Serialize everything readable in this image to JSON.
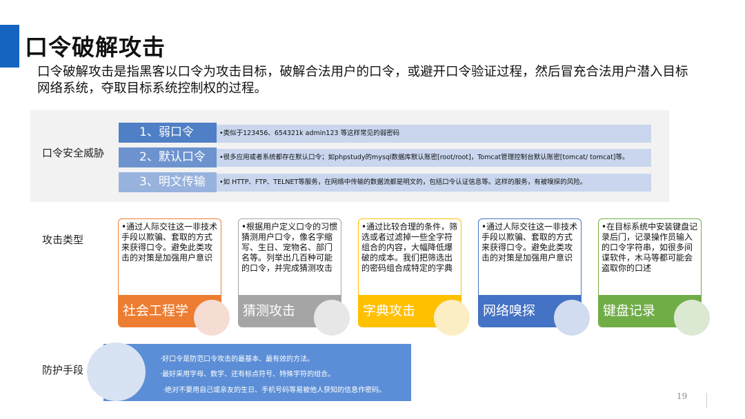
{
  "title": "口令破解攻击",
  "intro": "口令破解攻击是指黑客以口令为攻击目标，破解合法用户的口令，或避开口令验证过程，然后冒充合法用户潜入目标网络系统，夺取目标系统控制权的过程。",
  "threats": {
    "label": "口令安全威胁",
    "items": [
      {
        "name": "1、弱口令",
        "desc": "•类似于123456、654321k admin123 等这样常见的弱密码"
      },
      {
        "name": "2、默认口令",
        "desc": "•很多应用或者系统都存在默认口令；如phpstudy的mysql数据库默认账密[root/root]，Tomcat管理控制台默认账密[tomcat/ tomcat]等。"
      },
      {
        "name": "3、明文传输",
        "desc": "•如   HTTP、FTP、TELNET等服务，在网络中传输的数据流都是明文的，包括口令认证信息等。这样的服务，有被嗅探的风险。"
      }
    ]
  },
  "attacks": {
    "label": "攻击类型",
    "cards": [
      {
        "title": "社会工程学",
        "text": "•通过人际交往这一非技术手段以欺骗、套取的方式来获得口令。避免此类攻击的对策是加强用户意识"
      },
      {
        "title": "猜测攻击",
        "text": "•根据用户定义口令的习惯猜测用户口令，像名字缩写、生日、宠物名、部门名等。列举出几百种可能的口令，并完成猜测攻击"
      },
      {
        "title": "字典攻击",
        "text": "•通过比较合理的条件，筛选或者过滤掉一些全字符组合的内容，大幅降低爆破的成本。我们把筛选出的密码组合成特定的字典"
      },
      {
        "title": "网络嗅探",
        "text": "•通过人际交往这一非技术手段以欺骗、套取的方式来获得口令。避免此类攻击的对策是加强用户意识"
      },
      {
        "title": "键盘记录",
        "text": "•在目标系统中安装键盘记录后门，记录操作员输入的口令字符串，如很多间谍软件，木马等都可能会盗取你的口述"
      }
    ]
  },
  "defense": {
    "label": "防护手段",
    "lines": [
      "·好口令是防范口令攻击的最基本、最有效的方法。",
      "·最好采用字母、数字、还有标点符号、特殊字符的组合。",
      "·绝对不要用自己或亲友的生日、手机号码等易被他人获知的信息作密码。"
    ]
  },
  "page_number": "19",
  "colors": {
    "accent": "#1565c0",
    "threat_name_1": "#4f7fc4",
    "threat_name_2": "#6d93cf",
    "threat_name_3": "#97b2dd",
    "threat_desc": "#c9d6ee",
    "card_social": "#ed7d31",
    "card_guess": "#a5a5a5",
    "card_dict": "#ffc000",
    "card_sniff": "#4472c4",
    "card_keylog": "#70ad47",
    "defense": "#5b8ed6"
  }
}
